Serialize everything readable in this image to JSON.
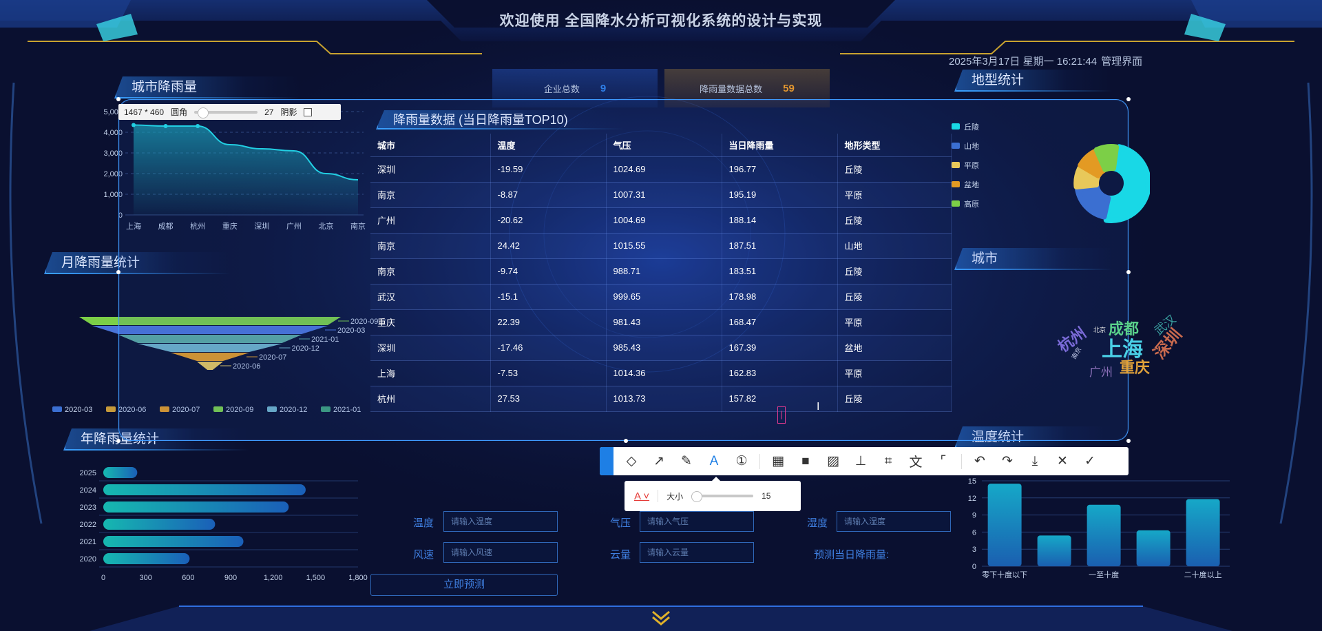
{
  "header": {
    "title": "欢迎使用 全国降水分析可视化系统的设计与实现",
    "datetime": "2025年3月17日 星期一 16:21:44",
    "admin_link": "管理界面"
  },
  "stats": [
    {
      "label": "企业总数",
      "value": "9",
      "color": "#2f7fe8"
    },
    {
      "label": "降雨量数据总数",
      "value": "59",
      "color": "#e2962f"
    }
  ],
  "panels": {
    "city_rain": "城市降雨量",
    "monthly": "月降雨量统计",
    "yearly": "年降雨量统计",
    "terrain": "地型统计",
    "city": "城市",
    "temperature": "温度统计",
    "table": "降雨量数据 (当日降雨量TOP10)"
  },
  "capture": {
    "size": "1467 * 460",
    "corner_label": "圆角",
    "corner_value": "27",
    "shadow_label": "阴影"
  },
  "table": {
    "headers": [
      "城市",
      "温度",
      "气压",
      "当日降雨量",
      "地形类型"
    ],
    "rows": [
      [
        "深圳",
        "-19.59",
        "1024.69",
        "196.77",
        "丘陵"
      ],
      [
        "南京",
        "-8.87",
        "1007.31",
        "195.19",
        "平原"
      ],
      [
        "广州",
        "-20.62",
        "1004.69",
        "188.14",
        "丘陵"
      ],
      [
        "南京",
        "24.42",
        "1015.55",
        "187.51",
        "山地"
      ],
      [
        "南京",
        "-9.74",
        "988.71",
        "183.51",
        "丘陵"
      ],
      [
        "武汉",
        "-15.1",
        "999.65",
        "178.98",
        "丘陵"
      ],
      [
        "重庆",
        "22.39",
        "981.43",
        "168.47",
        "平原"
      ],
      [
        "深圳",
        "-17.46",
        "985.43",
        "167.39",
        "盆地"
      ],
      [
        "上海",
        "-7.53",
        "1014.36",
        "162.83",
        "平原"
      ],
      [
        "杭州",
        "27.53",
        "1013.73",
        "157.82",
        "丘陵"
      ]
    ]
  },
  "toolbar": {
    "icons": [
      "shape-icon",
      "arrow-icon",
      "pen-icon",
      "text-icon",
      "number-icon",
      "mosaic-icon",
      "blur-icon",
      "hatch-icon",
      "pin-icon",
      "ocr-icon",
      "translate-icon",
      "scan-icon",
      "undo-icon",
      "redo-icon",
      "download-icon",
      "close-icon",
      "confirm-icon"
    ],
    "glyphs": [
      "◇",
      "↗",
      "✎",
      "A",
      "①",
      "▦",
      "■",
      "▨",
      "⊥",
      "⌗",
      "文",
      "⌜",
      "↶",
      "↷",
      "⤓",
      "✕",
      "✓"
    ]
  },
  "subbar": {
    "size_label": "大小",
    "size_value": "15"
  },
  "form": {
    "temp_label": "温度",
    "temp_placeholder": "请输入温度",
    "pressure_label": "气压",
    "pressure_placeholder": "请输入气压",
    "humidity_label": "湿度",
    "humidity_placeholder": "请输入湿度",
    "wind_label": "风速",
    "wind_placeholder": "请输入风速",
    "cloud_label": "云量",
    "cloud_placeholder": "请输入云量",
    "predict_label": "预测当日降雨量:",
    "predict_button": "立即预测"
  },
  "terrain_legend": [
    {
      "name": "丘陵",
      "color": "#19d8e6"
    },
    {
      "name": "山地",
      "color": "#3b6fd1"
    },
    {
      "name": "平原",
      "color": "#e8c85a"
    },
    {
      "name": "盆地",
      "color": "#e39a23"
    },
    {
      "name": "高原",
      "color": "#7ccf47"
    }
  ],
  "wordcloud": [
    "成都",
    "上海",
    "深圳",
    "重庆",
    "杭州",
    "广州",
    "武汉",
    "北京",
    "南京"
  ],
  "chart_data": [
    {
      "type": "area",
      "title": "城市降雨量",
      "categories": [
        "上海",
        "成都",
        "杭州",
        "重庆",
        "深圳",
        "广州",
        "北京",
        "南京"
      ],
      "values": [
        4350,
        4300,
        4300,
        3400,
        3200,
        3100,
        2000,
        1700
      ],
      "ylim": [
        0,
        5000
      ],
      "yticks": [
        "0",
        "1,000",
        "2,000",
        "3,000",
        "4,000",
        "5,000"
      ]
    },
    {
      "type": "funnel",
      "title": "月降雨量统计",
      "categories": [
        "2020-09",
        "2020-03",
        "2021-01",
        "2020-12",
        "2020-07",
        "2020-06"
      ],
      "values": [
        100,
        90,
        70,
        55,
        30,
        10
      ],
      "colors": [
        "#7ccf47",
        "#4a74d9",
        "#5aa9a0",
        "#6fb2c8",
        "#e39a23",
        "#e8c85a"
      ],
      "legend": [
        "2020-03",
        "2020-06",
        "2020-07",
        "2020-09",
        "2020-12",
        "2021-01"
      ],
      "legend_colors": [
        "#3b6fd1",
        "#c69a3a",
        "#e39a23",
        "#7ccf47",
        "#6fb2c8",
        "#3ea07a"
      ]
    },
    {
      "type": "bar",
      "title": "年降雨量统计",
      "categories": [
        "2025",
        "2024",
        "2023",
        "2022",
        "2021",
        "2020"
      ],
      "values": [
        240,
        1430,
        1310,
        790,
        990,
        610
      ],
      "xlim": [
        0,
        1800
      ],
      "xticks": [
        "0",
        "300",
        "600",
        "900",
        "1,200",
        "1,500",
        "1,800"
      ]
    },
    {
      "type": "pie",
      "title": "地型统计",
      "categories": [
        "丘陵",
        "山地",
        "平原",
        "盆地",
        "高原"
      ],
      "values": [
        5,
        2,
        1,
        1,
        1
      ]
    },
    {
      "type": "bar",
      "title": "温度统计",
      "categories": [
        "零下十度以下",
        "",
        "一至十度",
        "",
        "二十度以上"
      ],
      "values": [
        14.5,
        5.4,
        10.8,
        6.3,
        11.8
      ],
      "ylim": [
        0,
        15
      ],
      "yticks": [
        "0",
        "3",
        "6",
        "9",
        "12",
        "15"
      ],
      "xlabels": [
        "零下十度以下",
        "一至十度",
        "二十度以上"
      ]
    }
  ]
}
